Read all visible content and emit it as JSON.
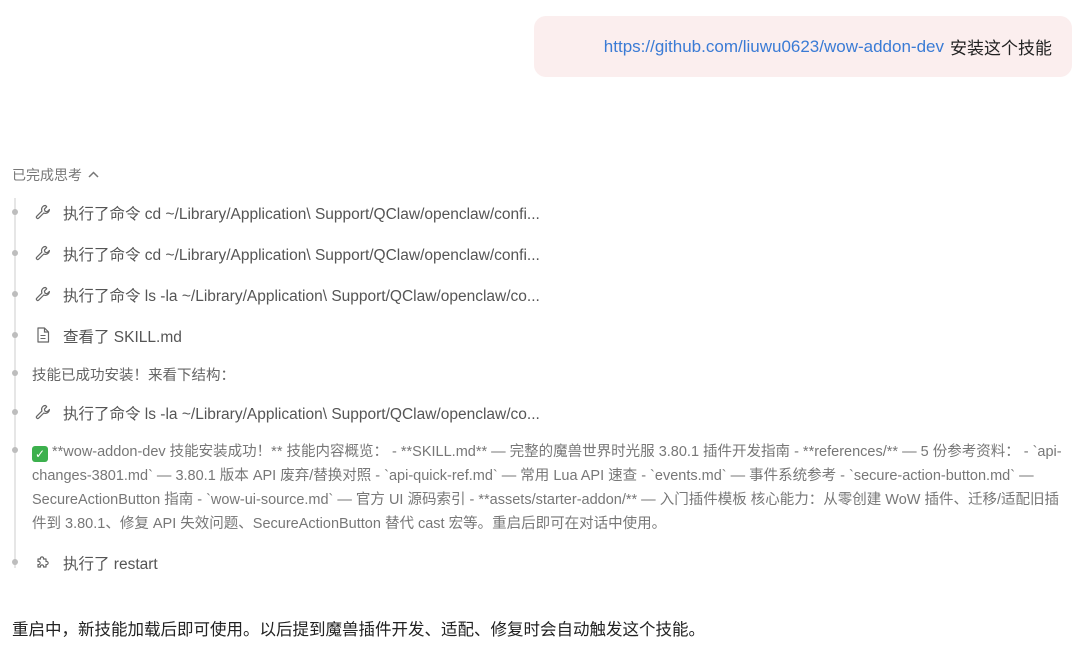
{
  "user_message": {
    "link": "https://github.com/liuwu0623/wow-addon-dev",
    "text": "安装这个技能"
  },
  "thinking": {
    "toggle_label": "已完成思考",
    "steps": [
      {
        "icon": "wrench-icon",
        "label": "执行了命令 cd ~/Library/Application\\ Support/QClaw/openclaw/confi..."
      },
      {
        "icon": "wrench-icon",
        "label": "执行了命令 cd ~/Library/Application\\ Support/QClaw/openclaw/confi..."
      },
      {
        "icon": "wrench-icon",
        "label": "执行了命令 ls -la ~/Library/Application\\ Support/QClaw/openclaw/co..."
      },
      {
        "icon": "document-icon",
        "label": "查看了 SKILL.md"
      },
      {
        "icon": "",
        "label": "技能已成功安装！来看下结构："
      },
      {
        "icon": "wrench-icon",
        "label": "执行了命令 ls -la ~/Library/Application\\ Support/QClaw/openclaw/co..."
      },
      {
        "icon": "puzzle-icon",
        "label": "执行了 restart"
      }
    ],
    "summary": "**wow-addon-dev 技能安装成功！** 技能内容概览：  - **SKILL.md** — 完整的魔兽世界时光服 3.80.1 插件开发指南 - **references/** — 5 份参考资料：  - `api-changes-3801.md` — 3.80.1 版本 API 废弃/替换对照 - `api-quick-ref.md` — 常用 Lua API 速查 - `events.md` — 事件系统参考 - `secure-action-button.md` — SecureActionButton 指南 - `wow-ui-source.md` — 官方 UI 源码索引 - **assets/starter-addon/** — 入门插件模板 核心能力：从零创建 WoW 插件、迁移/适配旧插件到 3.80.1、修复 API 失效问题、SecureActionButton 替代 cast 宏等。重启后即可在对话中使用。"
  },
  "assistant_message": "重启中，新技能加载后即可使用。以后提到魔兽插件开发、适配、修复时会自动触发这个技能。"
}
